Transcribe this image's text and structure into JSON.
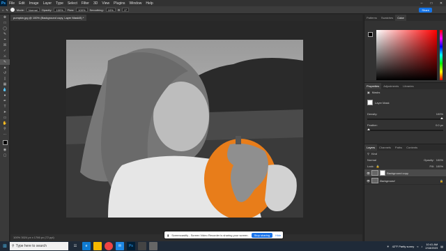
{
  "app": {
    "logo": "Ps",
    "menus": [
      "File",
      "Edit",
      "Image",
      "Layer",
      "Type",
      "Select",
      "Filter",
      "3D",
      "View",
      "Plugins",
      "Window",
      "Help"
    ]
  },
  "options": {
    "mode_label": "Mode:",
    "mode_value": "Normal",
    "opacity_label": "Opacity:",
    "opacity_value": "100%",
    "flow_label": "Flow:",
    "flow_value": "100%",
    "smoothing_label": "Smoothing:",
    "smoothing_value": "10%",
    "angle_value": "0°",
    "share_label": "Share"
  },
  "document": {
    "tab_title": "pumpkin.jpg @ 100% (Background copy, Layer Mask/8) *",
    "status_text": "100%  3024 px x 1766 px (72 ppi)"
  },
  "panels": {
    "color_tabs": [
      "Patterns",
      "Swatches",
      "Color"
    ],
    "props_tabs": [
      "Properties",
      "Adjustments",
      "Libraries"
    ],
    "masks_label": "Masks",
    "layer_mask_label": "Layer Mask",
    "density_label": "Density:",
    "density_value": "100%",
    "feather_label": "Feather:",
    "feather_value": "0.0 px",
    "layers_tabs": [
      "Layers",
      "Channels",
      "Paths",
      "Contents"
    ],
    "kind_label": "Kind",
    "blend_mode": "Normal",
    "opacity_label": "Opacity:",
    "opacity_value": "100%",
    "lock_label": "Lock:",
    "fill_label": "Fill:",
    "fill_value": "100%",
    "layers": [
      {
        "name": "Background copy",
        "selected": true
      },
      {
        "name": "Background",
        "selected": false
      }
    ]
  },
  "screen_share": {
    "message": "Screencastify - Screen Video Recorder is sharing your screen.",
    "stop_label": "Stop sharing",
    "hide_label": "Hide"
  },
  "taskbar": {
    "search_placeholder": "Type here to search",
    "weather": "42°F Partly sunny",
    "time": "10:41 AM",
    "date": "2/18/2023"
  },
  "colors": {
    "accent": "#1473e6",
    "pumpkin": "#e87d1a",
    "taskbar": "#1f2a38"
  }
}
